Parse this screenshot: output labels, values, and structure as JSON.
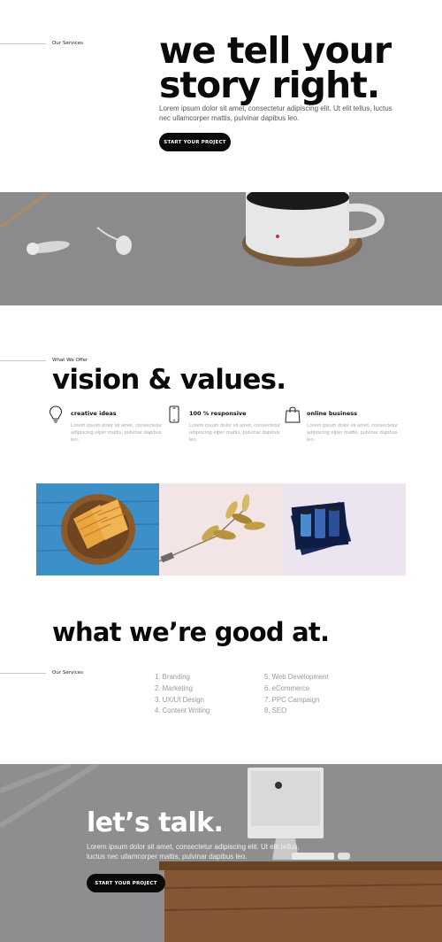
{
  "hero": {
    "tag": "Our Services",
    "title_line1": "we tell your",
    "title_line2": "story right.",
    "description": "Lorem ipsum dolor sit amet, consectetur adipiscing elit. Ut elit tellus, luctus nec ullamcorper mattis, pulvinar dapibus leo.",
    "cta_label": "START YOUR PROJECT"
  },
  "vision": {
    "tag": "What We Offer",
    "title": "vision & values.",
    "features": [
      {
        "icon": "lightbulb-icon",
        "title": "creative ideas",
        "description": "Lorem ipsum dolor sit amet, consectetur adipiscing elper mattis, pulvinar dapibus leo."
      },
      {
        "icon": "smartphone-icon",
        "title": "100 % responsive",
        "description": "Lorem ipsum dolor sit amet, consectetur adipiscing elper mattis, pulvinar dapibus leo."
      },
      {
        "icon": "shopping-bag-icon",
        "title": "online business",
        "description": "Lorem ipsum dolor sit amet, consectetur adipiscing elper mattis, pulvinar dapibus leo."
      }
    ]
  },
  "gallery": {
    "images": [
      "sandwich-plate-photo",
      "golden-leaf-photo",
      "cosmetics-box-photo"
    ]
  },
  "services": {
    "title": "what we’re good at.",
    "tag": "Our Services",
    "column1": [
      "1. Branding",
      "2. Marketing",
      "3. UX/UI Design",
      "4. Content Writing"
    ],
    "column2": [
      "5. Web Development",
      "6. eCommerce",
      "7. PPC Campaign",
      "8. SEO"
    ]
  },
  "contact": {
    "title": "let’s talk.",
    "description": "Lorem ipsum dolor sit amet, consectetur adipiscing elit. Ut elit tellus, luctus nec ullamcorper mattis, pulvinar dapibus leo.",
    "cta_label": "START YOUR PROJECT"
  },
  "colors": {
    "accent": "#0a0a0a",
    "muted_text": "#9a9a9a",
    "overlay_gray": "#8d8d8f",
    "gallery_blue": "#3d8fc7",
    "gallery_pink": "#f3e4e5",
    "gallery_lavender": "#ece4ef"
  }
}
